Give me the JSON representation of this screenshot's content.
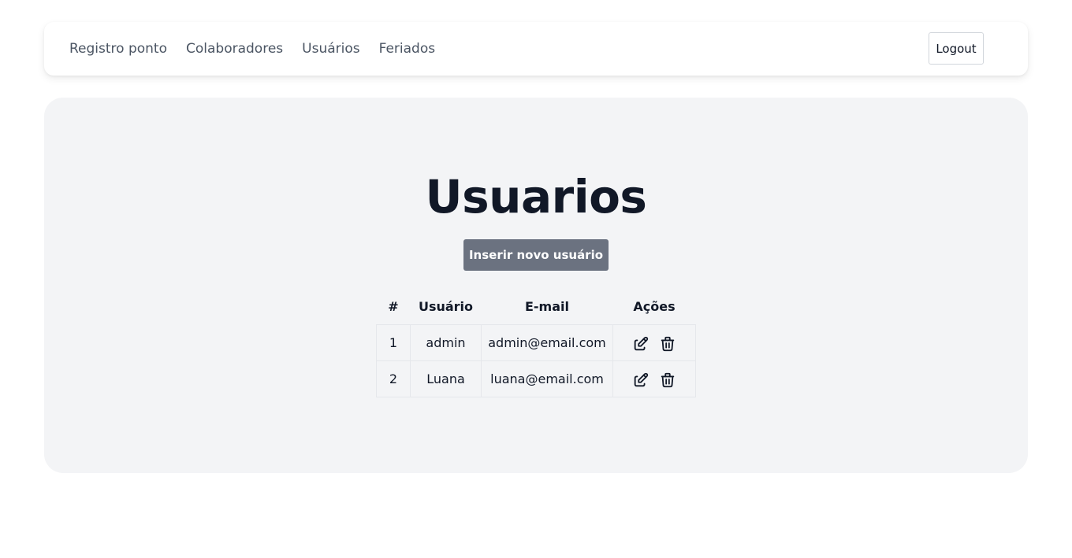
{
  "nav": {
    "links": [
      {
        "label": "Registro ponto"
      },
      {
        "label": "Colaboradores"
      },
      {
        "label": "Usuários"
      },
      {
        "label": "Feriados"
      }
    ],
    "logout_label": "Logout"
  },
  "main": {
    "title": "Usuarios",
    "add_button_label": "Inserir novo usuário",
    "table": {
      "headers": {
        "num": "#",
        "user": "Usuário",
        "email": "E-mail",
        "actions": "Ações"
      },
      "rows": [
        {
          "num": "1",
          "user": "admin",
          "email": "admin@email.com"
        },
        {
          "num": "2",
          "user": "Luana",
          "email": "luana@email.com"
        }
      ],
      "row_icons": [
        "edit-icon",
        "trash-icon"
      ]
    }
  },
  "colors": {
    "panel_background": "#f3f4f6",
    "primary_button": "#6b7280",
    "nav_text": "#4b5563",
    "title_text": "#111827"
  }
}
